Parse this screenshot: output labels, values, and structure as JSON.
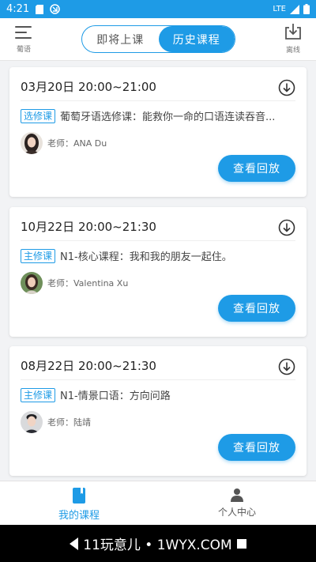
{
  "status_bar": {
    "time": "4:21",
    "network": "LTE"
  },
  "header": {
    "menu_caption": "葡语",
    "tabs": [
      {
        "label": "即将上课",
        "active": false
      },
      {
        "label": "历史课程",
        "active": true
      }
    ],
    "offline_caption": "离线"
  },
  "courses": [
    {
      "time": "03月20日 20:00~21:00",
      "badge": "选修课",
      "title": "葡萄牙语选修课：能救你一命的口语连读吞音...",
      "teacher": "老师：ANA Du",
      "action": "查看回放",
      "avatar_icon": "teacher-avatar-woman-dark-hair"
    },
    {
      "time": "10月22日 20:00~21:30",
      "badge": "主修课",
      "title": "N1-核心课程：我和我的朋友一起住。",
      "teacher": "老师：Valentina Xu",
      "action": "查看回放",
      "avatar_icon": "teacher-avatar-woman-green-background"
    },
    {
      "time": "08月22日 20:00~21:30",
      "badge": "主修课",
      "title": "N1-情景口语：方向问路",
      "teacher": "老师：陆靖",
      "action": "查看回放",
      "avatar_icon": "teacher-avatar-man"
    }
  ],
  "bottom_nav": [
    {
      "label": "我的课程",
      "active": true,
      "icon": "book-icon"
    },
    {
      "label": "个人中心",
      "active": false,
      "icon": "person-icon"
    }
  ],
  "system_nav": {
    "watermark": "11玩意儿 • 1WYX.COM"
  },
  "colors": {
    "accent": "#1e9be6",
    "background": "#f2f3f5"
  }
}
